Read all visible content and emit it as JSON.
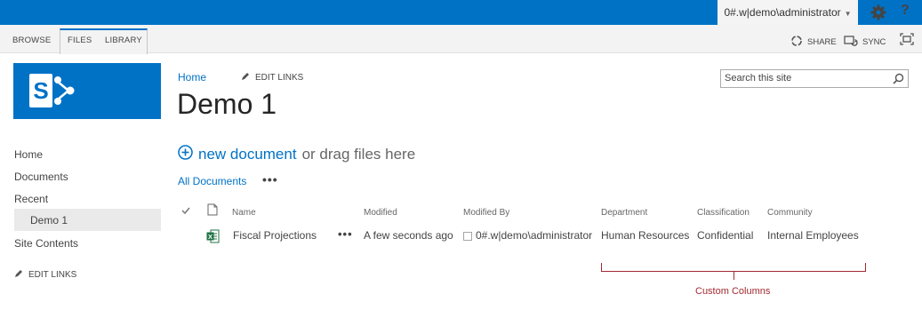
{
  "suite_bar": {
    "user": "0#.w|demo\\administrator",
    "help": "?"
  },
  "ribbon": {
    "tabs": [
      {
        "label": "BROWSE"
      },
      {
        "label": "FILES"
      },
      {
        "label": "LIBRARY"
      }
    ],
    "actions": {
      "share": "SHARE",
      "sync": "SYNC"
    }
  },
  "logo": {
    "letter": "S",
    "color": "#0072c6"
  },
  "left_nav": {
    "items": [
      "Home",
      "Documents",
      "Recent",
      "Demo 1",
      "Site Contents"
    ],
    "edit_links": "EDIT LINKS"
  },
  "header": {
    "breadcrumb": "Home",
    "edit_links": "EDIT LINKS",
    "title": "Demo 1"
  },
  "search": {
    "placeholder": "Search this site",
    "value": ""
  },
  "toolbar": {
    "new_document": "new document",
    "drag_text": "or drag files here",
    "view": "All Documents",
    "view_menu": "•••"
  },
  "list": {
    "columns": [
      "Name",
      "Modified",
      "Modified By",
      "Department",
      "Classification",
      "Community"
    ],
    "rows": [
      {
        "name": "Fiscal Projections",
        "modified": "A few seconds ago",
        "modified_by": "0#.w|demo\\administrator",
        "department": "Human Resources",
        "classification": "Confidential",
        "community": "Internal Employees",
        "file_type_icon": "excel-icon"
      }
    ],
    "row_menu": "•••"
  },
  "annotation": {
    "label": "Custom Columns",
    "color": "#a32a31"
  },
  "colors": {
    "accent": "#0072c6",
    "excel": "#217346"
  }
}
